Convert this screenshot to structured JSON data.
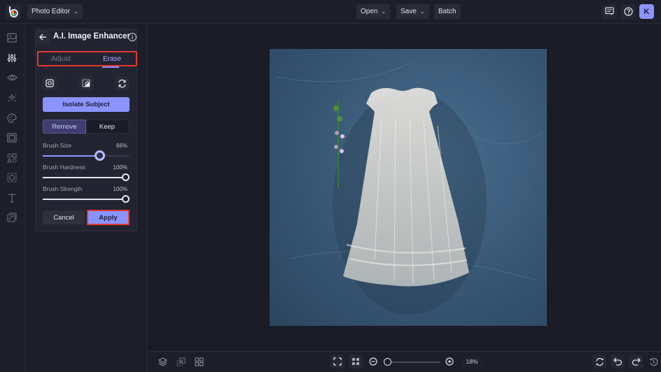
{
  "topbar": {
    "logo": "befunky-logo",
    "app_menu_label": "Photo Editor",
    "open_label": "Open",
    "save_label": "Save",
    "batch_label": "Batch",
    "avatar_initial": "K"
  },
  "sidebar": {
    "items": [
      {
        "icon": "image-icon",
        "label": "Edit"
      },
      {
        "icon": "sliders-icon",
        "label": "Edit",
        "active": true
      },
      {
        "icon": "eye-icon",
        "label": "Touch Up"
      },
      {
        "icon": "sparkles-icon",
        "label": "Effects"
      },
      {
        "icon": "palette-icon",
        "label": "Artsy"
      },
      {
        "icon": "frame-icon",
        "label": "Frames"
      },
      {
        "icon": "shapes-icon",
        "label": "Graphics"
      },
      {
        "icon": "overlay-icon",
        "label": "Overlays"
      },
      {
        "icon": "text-icon",
        "label": "Text"
      },
      {
        "icon": "textures-icon",
        "label": "Textures"
      }
    ]
  },
  "panel": {
    "title": "A.I. Image Enhancer",
    "tabs": [
      {
        "label": "Adjust",
        "active": false
      },
      {
        "label": "Erase",
        "active": true
      }
    ],
    "tools": [
      "brush-tool-icon",
      "invert-icon",
      "reset-icon"
    ],
    "isolate_label": "Isolate Subject",
    "mode": {
      "remove_label": "Remove",
      "keep_label": "Keep",
      "selected": "Remove"
    },
    "sliders": [
      {
        "label": "Brush Size",
        "value_text": "66%",
        "value": 0.66
      },
      {
        "label": "Brush Hardness",
        "value_text": "100%",
        "value": 1.0
      },
      {
        "label": "Brush Strength",
        "value_text": "100%",
        "value": 1.0
      }
    ],
    "cancel_label": "Cancel",
    "apply_label": "Apply"
  },
  "bottombar": {
    "zoom_text": "18%",
    "zoom_value": 0.02
  },
  "colors": {
    "accent": "#8b93ff",
    "highlight": "#e03a2f",
    "background": "#1a1b25"
  }
}
